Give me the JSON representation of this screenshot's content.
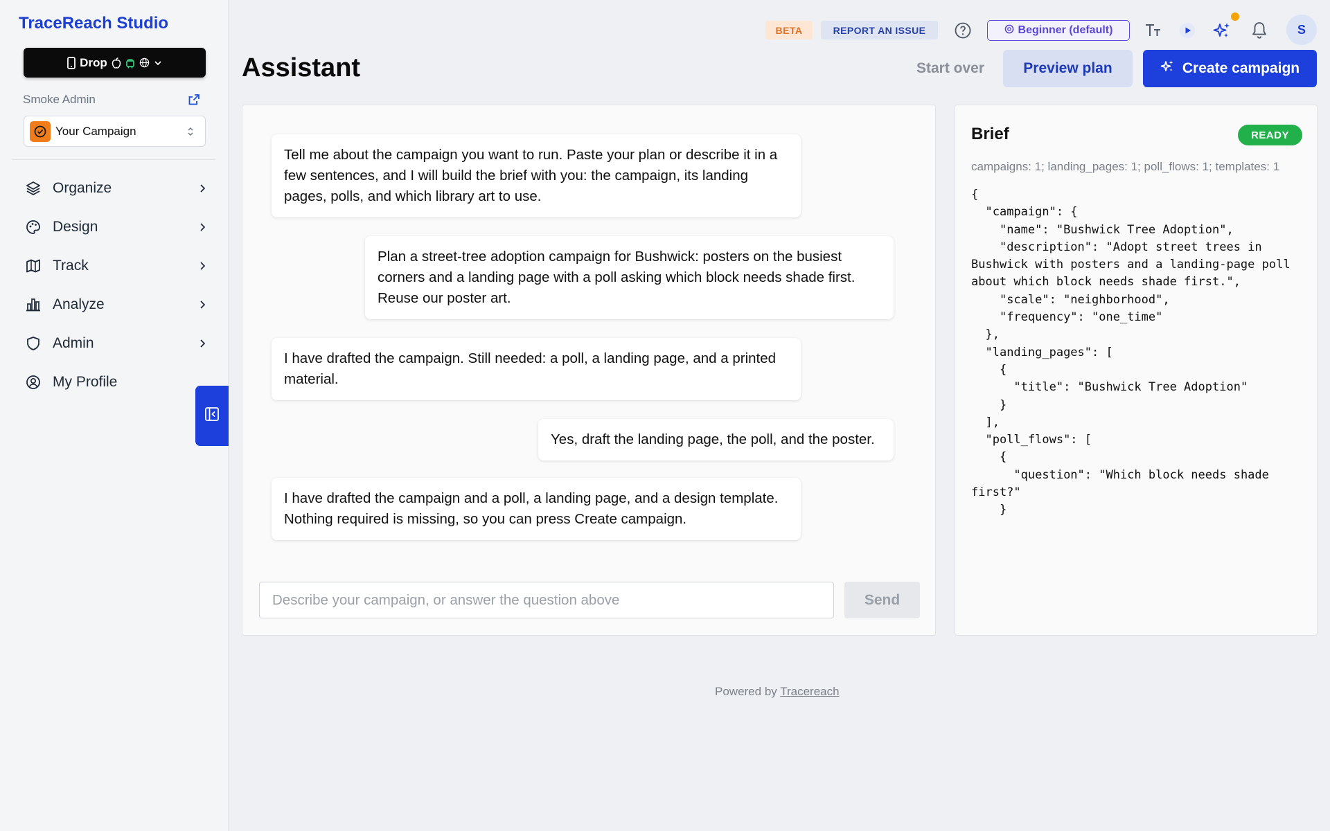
{
  "app": {
    "title": "TraceReach Studio"
  },
  "sidebar": {
    "platform_button": {
      "label": "Drop"
    },
    "org_label": "Smoke Admin",
    "campaign_select": {
      "value": "Your Campaign"
    },
    "items": [
      {
        "label": "Organize",
        "icon": "layers-icon"
      },
      {
        "label": "Design",
        "icon": "palette-icon"
      },
      {
        "label": "Track",
        "icon": "map-icon"
      },
      {
        "label": "Analyze",
        "icon": "bar-chart-icon"
      },
      {
        "label": "Admin",
        "icon": "shield-icon"
      },
      {
        "label": "My Profile",
        "icon": "user-circle-icon"
      }
    ]
  },
  "topbar": {
    "beta": "BETA",
    "report": "REPORT AN ISSUE",
    "level": "Beginner (default)",
    "avatar_initial": "S"
  },
  "header": {
    "title": "Assistant",
    "start_over": "Start over",
    "preview_plan": "Preview plan",
    "create_campaign": "Create campaign"
  },
  "chat": {
    "messages": [
      {
        "role": "assistant",
        "text": "Tell me about the campaign you want to run. Paste your plan or describe it in a few sentences, and I will build the brief with you: the campaign, its landing pages, polls, and which library art to use."
      },
      {
        "role": "user",
        "text": "Plan a street-tree adoption campaign for Bushwick: posters on the busiest corners and a landing page with a poll asking which block needs shade first. Reuse our poster art."
      },
      {
        "role": "assistant",
        "text": "I have drafted the campaign. Still needed: a poll, a landing page, and a printed material."
      },
      {
        "role": "user",
        "text": "Yes, draft the landing page, the poll, and the poster."
      },
      {
        "role": "assistant",
        "text": "I have drafted the campaign and a poll, a landing page, and a design template. Nothing required is missing, so you can press Create campaign."
      }
    ],
    "input_placeholder": "Describe your campaign, or answer the question above",
    "send": "Send"
  },
  "brief": {
    "title": "Brief",
    "status": "READY",
    "summary": "campaigns: 1; landing_pages: 1; poll_flows: 1; templates: 1",
    "json_text": "{\n  \"campaign\": {\n    \"name\": \"Bushwick Tree Adoption\",\n    \"description\": \"Adopt street trees in Bushwick with posters and a landing-page poll about which block needs shade first.\",\n    \"scale\": \"neighborhood\",\n    \"frequency\": \"one_time\"\n  },\n  \"landing_pages\": [\n    {\n      \"title\": \"Bushwick Tree Adoption\"\n    }\n  ],\n  \"poll_flows\": [\n    {\n      \"question\": \"Which block needs shade first?\"\n    }"
  },
  "footer": {
    "prefix": "Powered by",
    "link": "Tracereach"
  },
  "colors": {
    "brand": "#1d3fcf",
    "primary_button": "#1d3fdc",
    "ready_badge": "#22b04b",
    "beta_badge_text": "#e0712a",
    "level_badge": "#5b47d6"
  }
}
